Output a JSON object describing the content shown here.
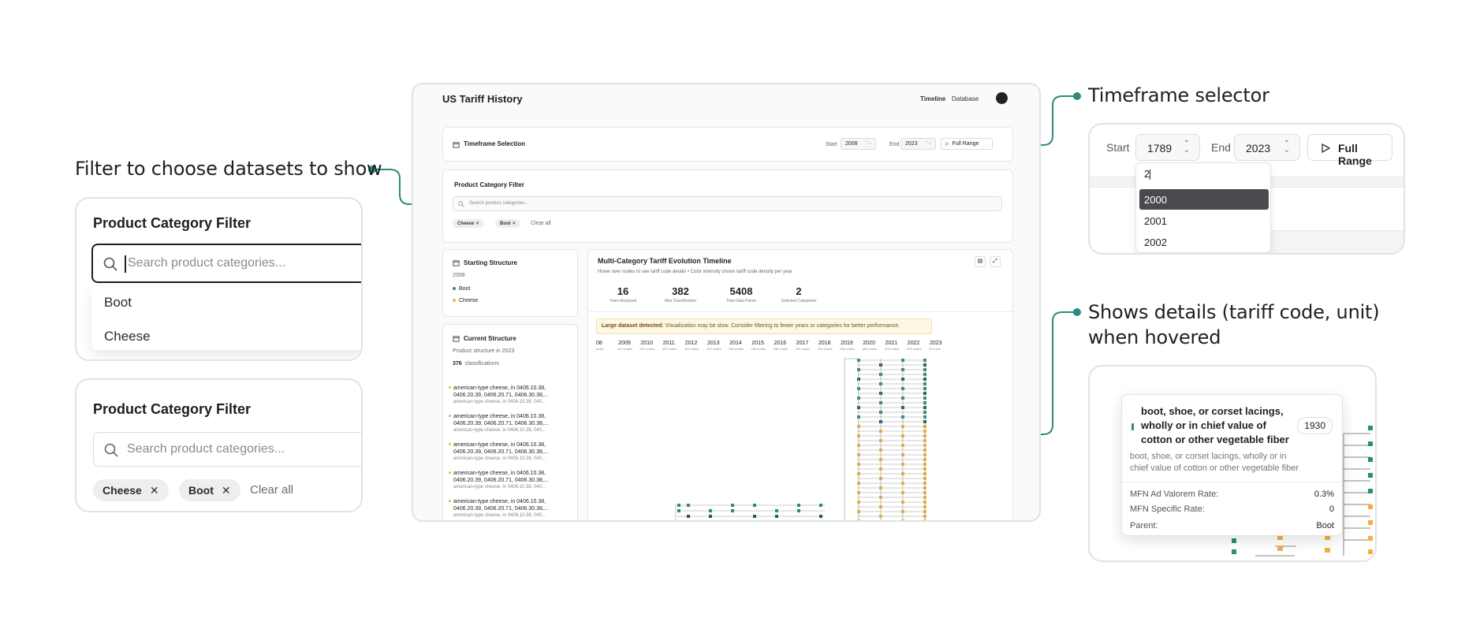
{
  "callouts": {
    "filter": "Filter to choose datasets to show",
    "timeframe": "Timeframe selector",
    "details_line1": "Shows details (tariff code, unit)",
    "details_line2": "when hovered"
  },
  "filter_zoom_open": {
    "title": "Product Category Filter",
    "search_placeholder": "Search product categories...",
    "options": [
      "Boot",
      "Cheese"
    ]
  },
  "filter_zoom_chips": {
    "title": "Product Category Filter",
    "search_placeholder": "Search product categories...",
    "chips": [
      "Cheese",
      "Boot"
    ],
    "clear_label": "Clear all"
  },
  "timeframe_zoom": {
    "start_label": "Start",
    "start_value": "1789",
    "end_label": "End",
    "end_value": "2023",
    "full_range_label": "Full Range",
    "typed": "2",
    "year_options": [
      "2000",
      "2001",
      "2002"
    ],
    "selected_option": "2000"
  },
  "tooltip_zoom": {
    "title": "boot, shoe, or corset lacings, wholly or in chief value of cotton or other vegetable fiber",
    "code": "1930",
    "description": "boot, shoe, or corset lacings, wholly or in chief value of cotton or other vegetable fiber",
    "rows": [
      {
        "label": "MFN Ad Valorem Rate:",
        "value": "0.3%"
      },
      {
        "label": "MFN Specific Rate:",
        "value": "0"
      },
      {
        "label": "Parent:",
        "value": "Boot"
      }
    ]
  },
  "app": {
    "title": "US Tariff History",
    "nav": [
      "Timeline",
      "Database"
    ],
    "timeframe": {
      "title": "Timeframe Selection",
      "start_label": "Start",
      "start_value": "2008",
      "end_label": "End",
      "end_value": "2023",
      "full_range_label": "Full Range"
    },
    "filter": {
      "title": "Product Category Filter",
      "placeholder": "Search product categories...",
      "chips": [
        "Cheese",
        "Boot"
      ],
      "clear_label": "Clear all"
    },
    "starting_structure": {
      "title": "Starting Structure",
      "year": "2008",
      "legend": [
        {
          "label": "Boot",
          "color": "#2f8a7e"
        },
        {
          "label": "Cheese",
          "color": "#f0b23f"
        }
      ]
    },
    "current_structure": {
      "title": "Current Structure",
      "subtitle": "Product structure in 2023",
      "count": "376",
      "count_label": "classifications",
      "items": [
        {
          "line1": "american-type cheese, in 0406.10.38,",
          "line2": "0406.20.39, 0406.20.71, 0406.30.38,...",
          "sub": "american-type cheese, in 0406.10.38, 040..."
        },
        {
          "line1": "american-type cheese, in 0406.10.38,",
          "line2": "0406.20.39, 0406.20.71, 0406.30.38,...",
          "sub": "american-type cheese, in 0406.10.38, 040..."
        },
        {
          "line1": "american-type cheese, in 0406.10.38,",
          "line2": "0406.20.39, 0406.20.71, 0406.30.38,...",
          "sub": "american-type cheese, in 0406.10.38, 040..."
        },
        {
          "line1": "american-type cheese, in 0406.10.38,",
          "line2": "0406.20.39, 0406.20.71, 0406.30.38,...",
          "sub": "american-type cheese, in 0406.10.38, 040..."
        },
        {
          "line1": "american-type cheese, in 0406.10.38,",
          "line2": "0406.20.39, 0406.20.71, 0406.30.38,...",
          "sub": "american-type cheese, in 0406.10.38, 040..."
        }
      ]
    },
    "timeline": {
      "title": "Multi-Category Tariff Evolution Timeline",
      "subtitle": "Hover over nodes to see tariff code details • Color intensity shows tariff code density per year",
      "stats": [
        {
          "value": "16",
          "label": "Years Analyzed"
        },
        {
          "value": "382",
          "label": "Max Classification"
        },
        {
          "value": "5408",
          "label": "Total Data Points"
        },
        {
          "value": "2",
          "label": "Selected Categories"
        }
      ],
      "warning_bold": "Large dataset detected:",
      "warning_text": " Visualization may be slow. Consider filtering to fewer years or categories for better performance.",
      "years": [
        {
          "year": "08",
          "nodes": "nodes"
        },
        {
          "year": "2009",
          "nodes": "312 nodes"
        },
        {
          "year": "2010",
          "nodes": "307 nodes"
        },
        {
          "year": "2011",
          "nodes": "307 nodes"
        },
        {
          "year": "2012",
          "nodes": "343 nodes"
        },
        {
          "year": "2013",
          "nodes": "337 nodes"
        },
        {
          "year": "2014",
          "nodes": "336 nodes"
        },
        {
          "year": "2015",
          "nodes": "336 nodes"
        },
        {
          "year": "2016",
          "nodes": "336 nodes"
        },
        {
          "year": "2017",
          "nodes": "334 nodes"
        },
        {
          "year": "2018",
          "nodes": "334 nodes"
        },
        {
          "year": "2019",
          "nodes": "326 nodes"
        },
        {
          "year": "2020",
          "nodes": "382 nodes"
        },
        {
          "year": "2021",
          "nodes": "379 nodes"
        },
        {
          "year": "2022",
          "nodes": "378 nodes"
        },
        {
          "year": "2023",
          "nodes": "376 nod"
        }
      ]
    }
  },
  "colors": {
    "accent": "#2f8a7e",
    "boot": "#2f8a7e",
    "boot_dark": "#1f5d55",
    "cheese": "#f0b23f"
  }
}
